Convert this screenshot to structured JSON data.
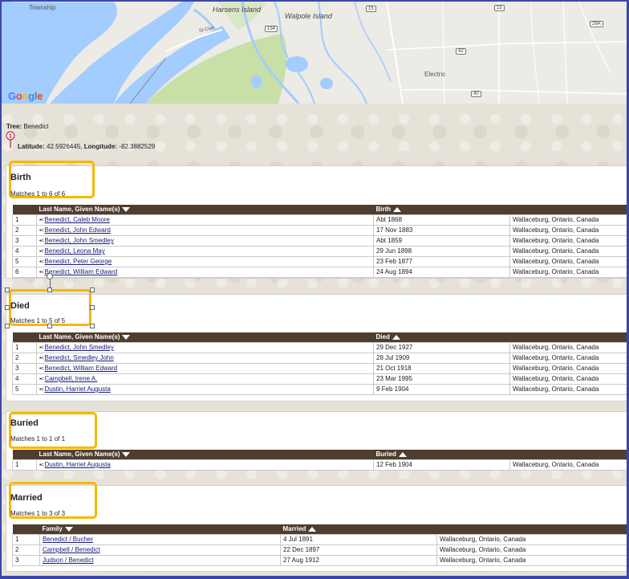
{
  "map": {
    "labels": {
      "township": "Township",
      "harsens_island": "Harsens Island",
      "walpole_island": "Walpole Island",
      "electric": "Electric",
      "st_clair": "St Clair"
    },
    "road_shields": [
      "15",
      "154",
      "42",
      "29A",
      "40",
      "15"
    ],
    "logo": "Google",
    "logo_colors": [
      "#4285F4",
      "#EA4335",
      "#FBBC05",
      "#4285F4",
      "#34A853",
      "#EA4335"
    ]
  },
  "info": {
    "tree_label": "Tree:",
    "tree_value": "Benedict",
    "pin_number": "1",
    "latitude_label": "Latitude:",
    "latitude_value": "42.5926445",
    "longitude_label": "Longitude:",
    "longitude_value": "-82.3882529"
  },
  "sections": {
    "birth": {
      "title": "Birth",
      "matches": "Matches 1 to 6 of 6",
      "col_name": "Last Name, Given Name(s)",
      "col_date": "Birth",
      "rows": [
        {
          "n": "1",
          "name": "Benedict, Caleb Moore",
          "date": "Abt 1868",
          "place": "Wallaceburg, Ontario, Canada"
        },
        {
          "n": "2",
          "name": "Benedict, John Edward",
          "date": "17 Nov 1883",
          "place": "Wallaceburg, Ontario, Canada"
        },
        {
          "n": "3",
          "name": "Benedict, John Smedley",
          "date": "Abt 1859",
          "place": "Wallaceburg, Ontario, Canada"
        },
        {
          "n": "4",
          "name": "Benedict, Leona May",
          "date": "29 Jun 1898",
          "place": "Wallaceburg, Ontario, Canada"
        },
        {
          "n": "5",
          "name": "Benedict, Peter George",
          "date": "23 Feb 1877",
          "place": "Wallaceburg, Ontario, Canada"
        },
        {
          "n": "6",
          "name": "Benedict, William Edward",
          "date": "24 Aug 1894",
          "place": "Wallaceburg, Ontario, Canada"
        }
      ]
    },
    "died": {
      "title": "Died",
      "matches": "Matches 1 to 5 of 5",
      "col_name": "Last Name, Given Name(s)",
      "col_date": "Died",
      "rows": [
        {
          "n": "1",
          "name": "Benedict, John Smedley",
          "date": "29 Dec 1927",
          "place": "Wallaceburg, Ontario, Canada"
        },
        {
          "n": "2",
          "name": "Benedict, Smedley John",
          "date": "28 Jul 1909",
          "place": "Wallaceburg, Ontario, Canada"
        },
        {
          "n": "3",
          "name": "Benedict, William Edward",
          "date": "21 Oct 1918",
          "place": "Wallaceburg, Ontario, Canada"
        },
        {
          "n": "4",
          "name": "Campbell, Irene A.",
          "date": "23 Mar 1995",
          "place": "Wallaceburg, Ontario, Canada"
        },
        {
          "n": "5",
          "name": "Dustin, Harriet Augusta",
          "date": "9 Feb 1904",
          "place": "Wallaceburg, Ontario, Canada"
        }
      ]
    },
    "buried": {
      "title": "Buried",
      "matches": "Matches 1 to 1 of 1",
      "col_name": "Last Name, Given Name(s)",
      "col_date": "Buried",
      "rows": [
        {
          "n": "1",
          "name": "Dustin, Harriet Augusta",
          "date": "12 Feb 1904",
          "place": "Wallaceburg, Ontario, Canada"
        }
      ]
    },
    "married": {
      "title": "Married",
      "matches": "Matches 1 to 3 of 3",
      "col_name": "Family",
      "col_date": "Married",
      "rows": [
        {
          "n": "1",
          "name": "Benedict / Bucher",
          "date": "4 Jul 1891",
          "place": "Wallaceburg, Ontario, Canada"
        },
        {
          "n": "2",
          "name": "Campbell / Benedict",
          "date": "22 Dec 1897",
          "place": "Wallaceburg, Ontario, Canada"
        },
        {
          "n": "3",
          "name": "Judson / Benedict",
          "date": "27 Aug 1912",
          "place": "Wallaceburg, Ontario, Canada"
        }
      ]
    }
  },
  "colors": {
    "header_bg": "#4f3e30",
    "highlight": "#f5b800",
    "frame": "#3b47a8",
    "water": "#a3ccff"
  }
}
